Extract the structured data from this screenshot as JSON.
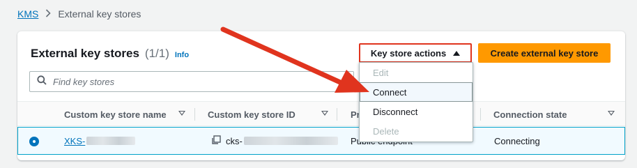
{
  "breadcrumb": {
    "root": "KMS",
    "current": "External key stores"
  },
  "panel": {
    "title": "External key stores",
    "count": "(1/1)",
    "info": "Info",
    "actions_label": "Key store actions",
    "create_label": "Create external key store"
  },
  "search": {
    "placeholder": "Find key stores"
  },
  "table": {
    "columns": [
      "Custom key store name",
      "Custom key store ID",
      "Pr",
      "Connection state"
    ],
    "rows": [
      {
        "name": "XKS-",
        "id": "cks-",
        "type": "Public endpoint",
        "state": "Connecting"
      }
    ]
  },
  "dropdown": {
    "items": [
      {
        "label": "Edit",
        "disabled": true
      },
      {
        "label": "Connect",
        "disabled": false
      },
      {
        "label": "Disconnect",
        "disabled": false
      },
      {
        "label": "Delete",
        "disabled": true
      }
    ]
  },
  "colors": {
    "primary": "#ff9900",
    "link": "#0073bb",
    "annotation": "#e0341e"
  },
  "icons": {
    "breadcrumb_separator": "chevron-right-icon",
    "search": "search-icon",
    "copy": "copy-icon",
    "caret": "caret-up-icon",
    "sort": "sort-down-icon"
  }
}
